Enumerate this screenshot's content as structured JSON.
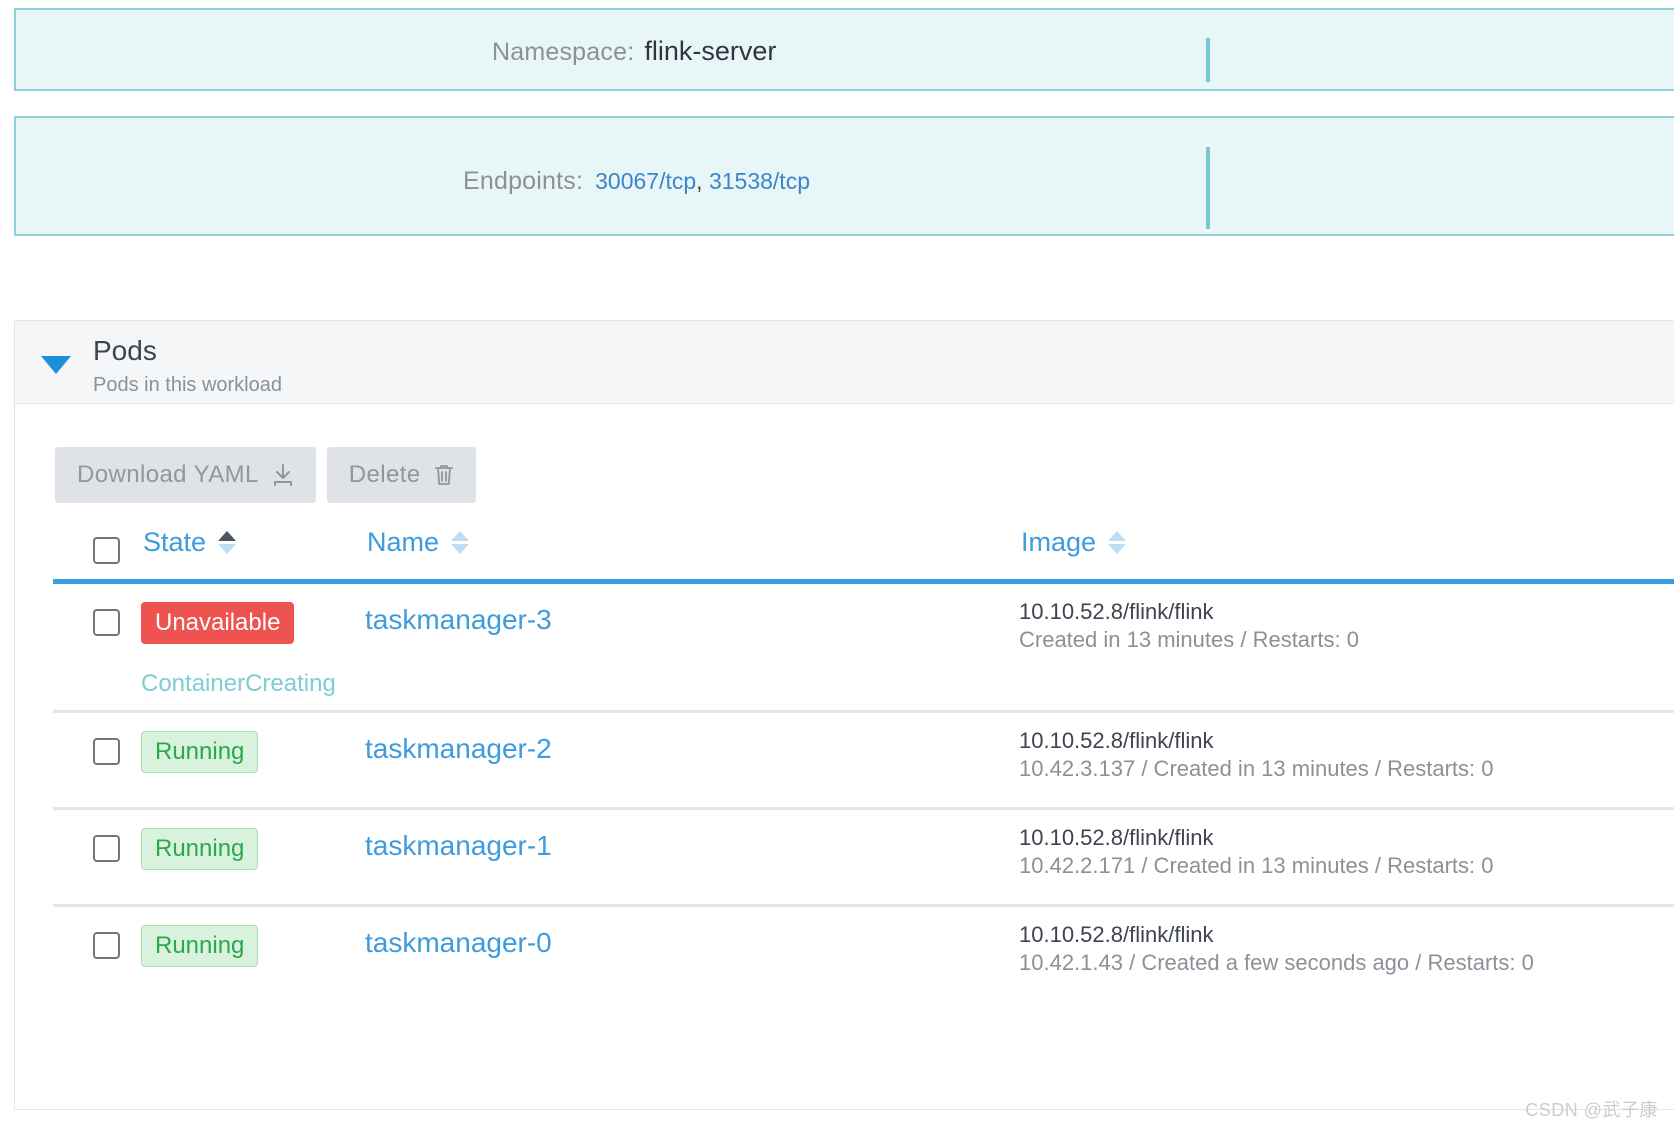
{
  "panels": {
    "namespace": {
      "label": "Namespace:",
      "value": "flink-server"
    },
    "endpoints": {
      "label": "Endpoints:",
      "value_1": "30067/tcp",
      "separator": ", ",
      "value_2": "31538/tcp"
    }
  },
  "pods_card": {
    "title": "Pods",
    "subtitle": "Pods in this workload",
    "toolbar": {
      "download_yaml_label": "Download YAML",
      "delete_label": "Delete"
    },
    "table": {
      "columns": [
        {
          "label": "State",
          "sort": "asc"
        },
        {
          "label": "Name",
          "sort": "none"
        },
        {
          "label": "Image",
          "sort": "none"
        }
      ],
      "rows": [
        {
          "state": "Unavailable",
          "state_kind": "unavailable",
          "substate": "ContainerCreating",
          "name": "taskmanager-3",
          "image": "10.10.52.8/flink/flink",
          "image_sub": "Created in 13 minutes / Restarts: 0"
        },
        {
          "state": "Running",
          "state_kind": "running",
          "substate": "",
          "name": "taskmanager-2",
          "image": "10.10.52.8/flink/flink",
          "image_sub": "10.42.3.137 / Created in 13 minutes / Restarts: 0"
        },
        {
          "state": "Running",
          "state_kind": "running",
          "substate": "",
          "name": "taskmanager-1",
          "image": "10.10.52.8/flink/flink",
          "image_sub": "10.42.2.171 / Created in 13 minutes / Restarts: 0"
        },
        {
          "state": "Running",
          "state_kind": "running",
          "substate": "",
          "name": "taskmanager-0",
          "image": "10.10.52.8/flink/flink",
          "image_sub": "10.42.1.43 / Created a few seconds ago / Restarts: 0"
        }
      ]
    }
  },
  "watermark": "CSDN @武子康",
  "colors": {
    "panel_bg": "#e9f6f8",
    "panel_border": "#8ed0da",
    "link": "#3e9bdd",
    "header_rule": "#3a9fe0",
    "badge_unavailable_bg": "#ef5350",
    "badge_running_bg": "#d9f2de",
    "badge_running_text": "#2ba84a",
    "substate_text": "#7fccd4"
  }
}
